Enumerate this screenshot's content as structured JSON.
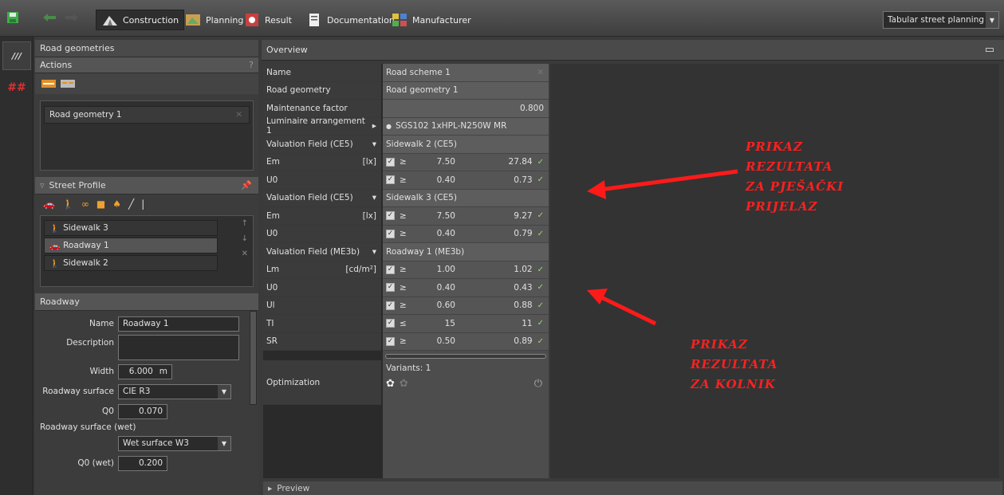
{
  "toolbar": {
    "tabs": [
      {
        "label": "Construction"
      },
      {
        "label": "Planning"
      },
      {
        "label": "Result"
      },
      {
        "label": "Documentation"
      },
      {
        "label": "Manufacturer"
      }
    ],
    "mode_select": "Tabular street planning"
  },
  "left_panel": {
    "title": "Road geometries",
    "actions_title": "Actions",
    "actions_help": "?",
    "geometry_item": "Road geometry 1",
    "street_profile_title": "Street Profile",
    "profile_items": [
      {
        "label": "Sidewalk 3"
      },
      {
        "label": "Roadway 1"
      },
      {
        "label": "Sidewalk 2"
      }
    ],
    "roadway_title": "Roadway",
    "fields": {
      "name_label": "Name",
      "name_value": "Roadway 1",
      "description_label": "Description",
      "width_label": "Width",
      "width_value": "6.000",
      "width_unit": "m",
      "surface_label": "Roadway surface",
      "surface_value": "CIE R3",
      "q0_label": "Q0",
      "q0_value": "0.070",
      "wet_label": "Roadway surface (wet)",
      "wet_value": "Wet surface W3",
      "q0wet_label": "Q0 (wet)",
      "q0wet_value": "0.200"
    }
  },
  "overview": {
    "title": "Overview",
    "preview": "Preview",
    "rows": [
      {
        "label": "Name",
        "unit": "",
        "value": "Road scheme 1"
      },
      {
        "label": "Road geometry",
        "unit": "",
        "value": "Road geometry 1"
      },
      {
        "label": "Maintenance factor",
        "unit": "",
        "value": "0.800"
      },
      {
        "label": "Luminaire arrangement 1",
        "unit": "▸",
        "value": "SGS102 1xHPL-N250W MR"
      },
      {
        "label": "Valuation Field (CE5)",
        "unit": "▾",
        "value": "Sidewalk 2 (CE5)"
      },
      {
        "label": "Em",
        "unit": "[lx]",
        "op": "≥",
        "req": "7.50",
        "res": "27.84"
      },
      {
        "label": "U0",
        "unit": "",
        "op": "≥",
        "req": "0.40",
        "res": "0.73"
      },
      {
        "label": "Valuation Field (CE5)",
        "unit": "▾",
        "value": "Sidewalk 3 (CE5)"
      },
      {
        "label": "Em",
        "unit": "[lx]",
        "op": "≥",
        "req": "7.50",
        "res": "9.27"
      },
      {
        "label": "U0",
        "unit": "",
        "op": "≥",
        "req": "0.40",
        "res": "0.79"
      },
      {
        "label": "Valuation Field (ME3b)",
        "unit": "▾",
        "value": "Roadway 1 (ME3b)"
      },
      {
        "label": "Lm",
        "unit": "[cd/m²]",
        "op": "≥",
        "req": "1.00",
        "res": "1.02"
      },
      {
        "label": "U0",
        "unit": "",
        "op": "≥",
        "req": "0.40",
        "res": "0.43"
      },
      {
        "label": "Ul",
        "unit": "",
        "op": "≥",
        "req": "0.60",
        "res": "0.88"
      },
      {
        "label": "TI",
        "unit": "",
        "op": "≤",
        "req": "15",
        "res": "11"
      },
      {
        "label": "SR",
        "unit": "",
        "op": "≥",
        "req": "0.50",
        "res": "0.89"
      }
    ],
    "optimization_label": "Optimization",
    "variants": "Variants: 1"
  },
  "annotations": {
    "pedestrian": [
      "PRIKAZ",
      "REZULTATA",
      "ZA PJEŠAČKI",
      "PRIJELAZ"
    ],
    "roadway": [
      "PRIKAZ",
      "REZULTATA",
      "ZA KOLNIK"
    ]
  }
}
